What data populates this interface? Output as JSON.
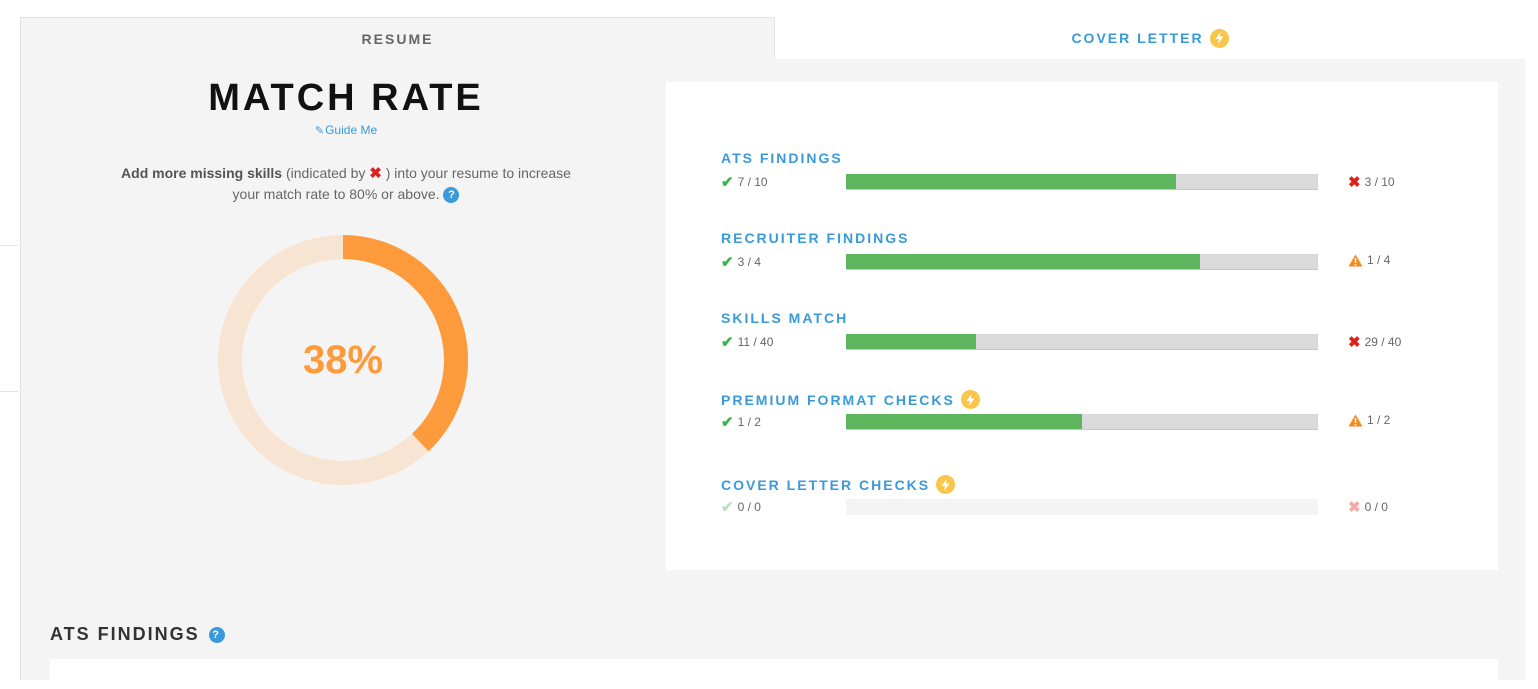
{
  "tabs": {
    "resume": "RESUME",
    "cover_letter": "COVER LETTER"
  },
  "match": {
    "title": "MATCH RATE",
    "guide_me": "Guide Me",
    "hint_bold": "Add more missing skills",
    "hint_mid": " (indicated by ",
    "hint_end": " ) into your resume to increase your match rate to 80% or above. ",
    "rate_label": "38%",
    "rate_value": 38,
    "colors": {
      "progress": "#fd9a3c",
      "track": "#f8e4d2"
    }
  },
  "metrics": [
    {
      "title": "ATS FINDINGS",
      "premium": false,
      "pass": "7 / 10",
      "fail": "3 / 10",
      "fail_icon": "x-icon",
      "fraction": 0.7
    },
    {
      "title": "RECRUITER FINDINGS",
      "premium": false,
      "pass": "3 / 4",
      "fail": "1 / 4",
      "fail_icon": "warning-icon",
      "fraction": 0.75
    },
    {
      "title": "SKILLS MATCH",
      "premium": false,
      "pass": "11 / 40",
      "fail": "29 / 40",
      "fail_icon": "x-icon",
      "fraction": 0.275
    },
    {
      "title": "PREMIUM FORMAT CHECKS",
      "premium": true,
      "pass": "1 / 2",
      "fail": "1 / 2",
      "fail_icon": "warning-icon",
      "fraction": 0.5
    },
    {
      "title": "COVER LETTER CHECKS",
      "premium": true,
      "pass": "0 / 0",
      "fail": "0 / 0",
      "fail_icon": "x-icon",
      "fraction": 0
    }
  ],
  "section": {
    "title": "ATS FINDINGS"
  },
  "icons": {
    "bolt": "lightning-bolt-icon",
    "help": "question-mark-icon",
    "wand": "magic-wand-icon",
    "check": "checkmark-icon"
  },
  "colors": {
    "accent": "#3a9ad9",
    "bar_fill": "#5db65e",
    "bar_track": "#dadada",
    "fail_red": "#e0201b",
    "warn_orange": "#f58a1f",
    "premium_yellow": "#f7c64a"
  }
}
